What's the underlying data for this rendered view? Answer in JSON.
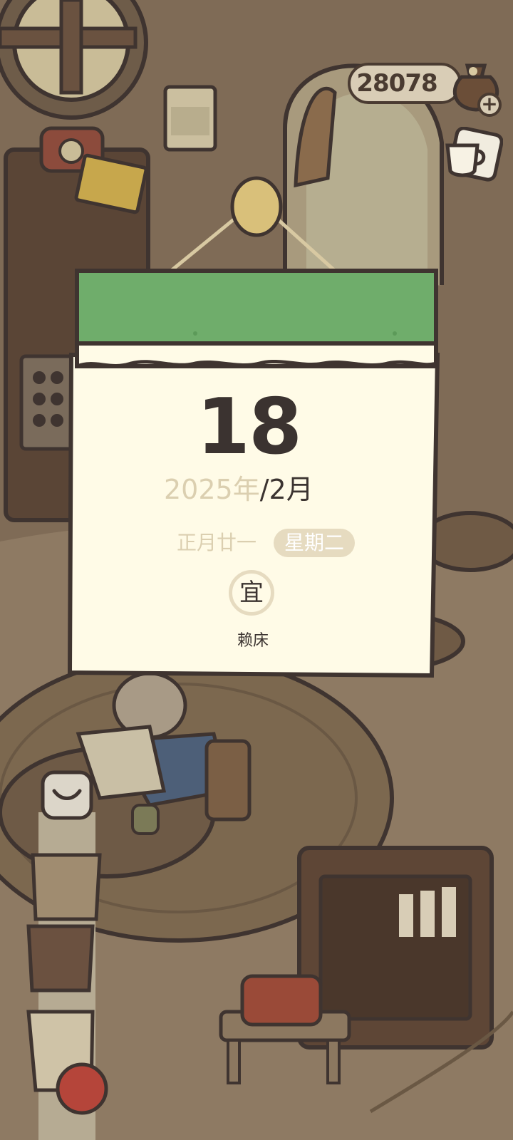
{
  "hud": {
    "coins": "28078",
    "plus_label": "+"
  },
  "calendar": {
    "day": "18",
    "year": "2025年",
    "month": "/2月",
    "lunar_date": "正月廿一",
    "weekday": "星期二",
    "suitable_label": "宜",
    "suitable_activity": "赖床"
  },
  "colors": {
    "calendar_header": "#6fad6b",
    "calendar_paper": "#fffbe7",
    "outline": "#3f3430",
    "muted_text": "#dbcfb0"
  },
  "icons": [
    "money-bag-icon",
    "teacup-icon",
    "mail-icon"
  ]
}
